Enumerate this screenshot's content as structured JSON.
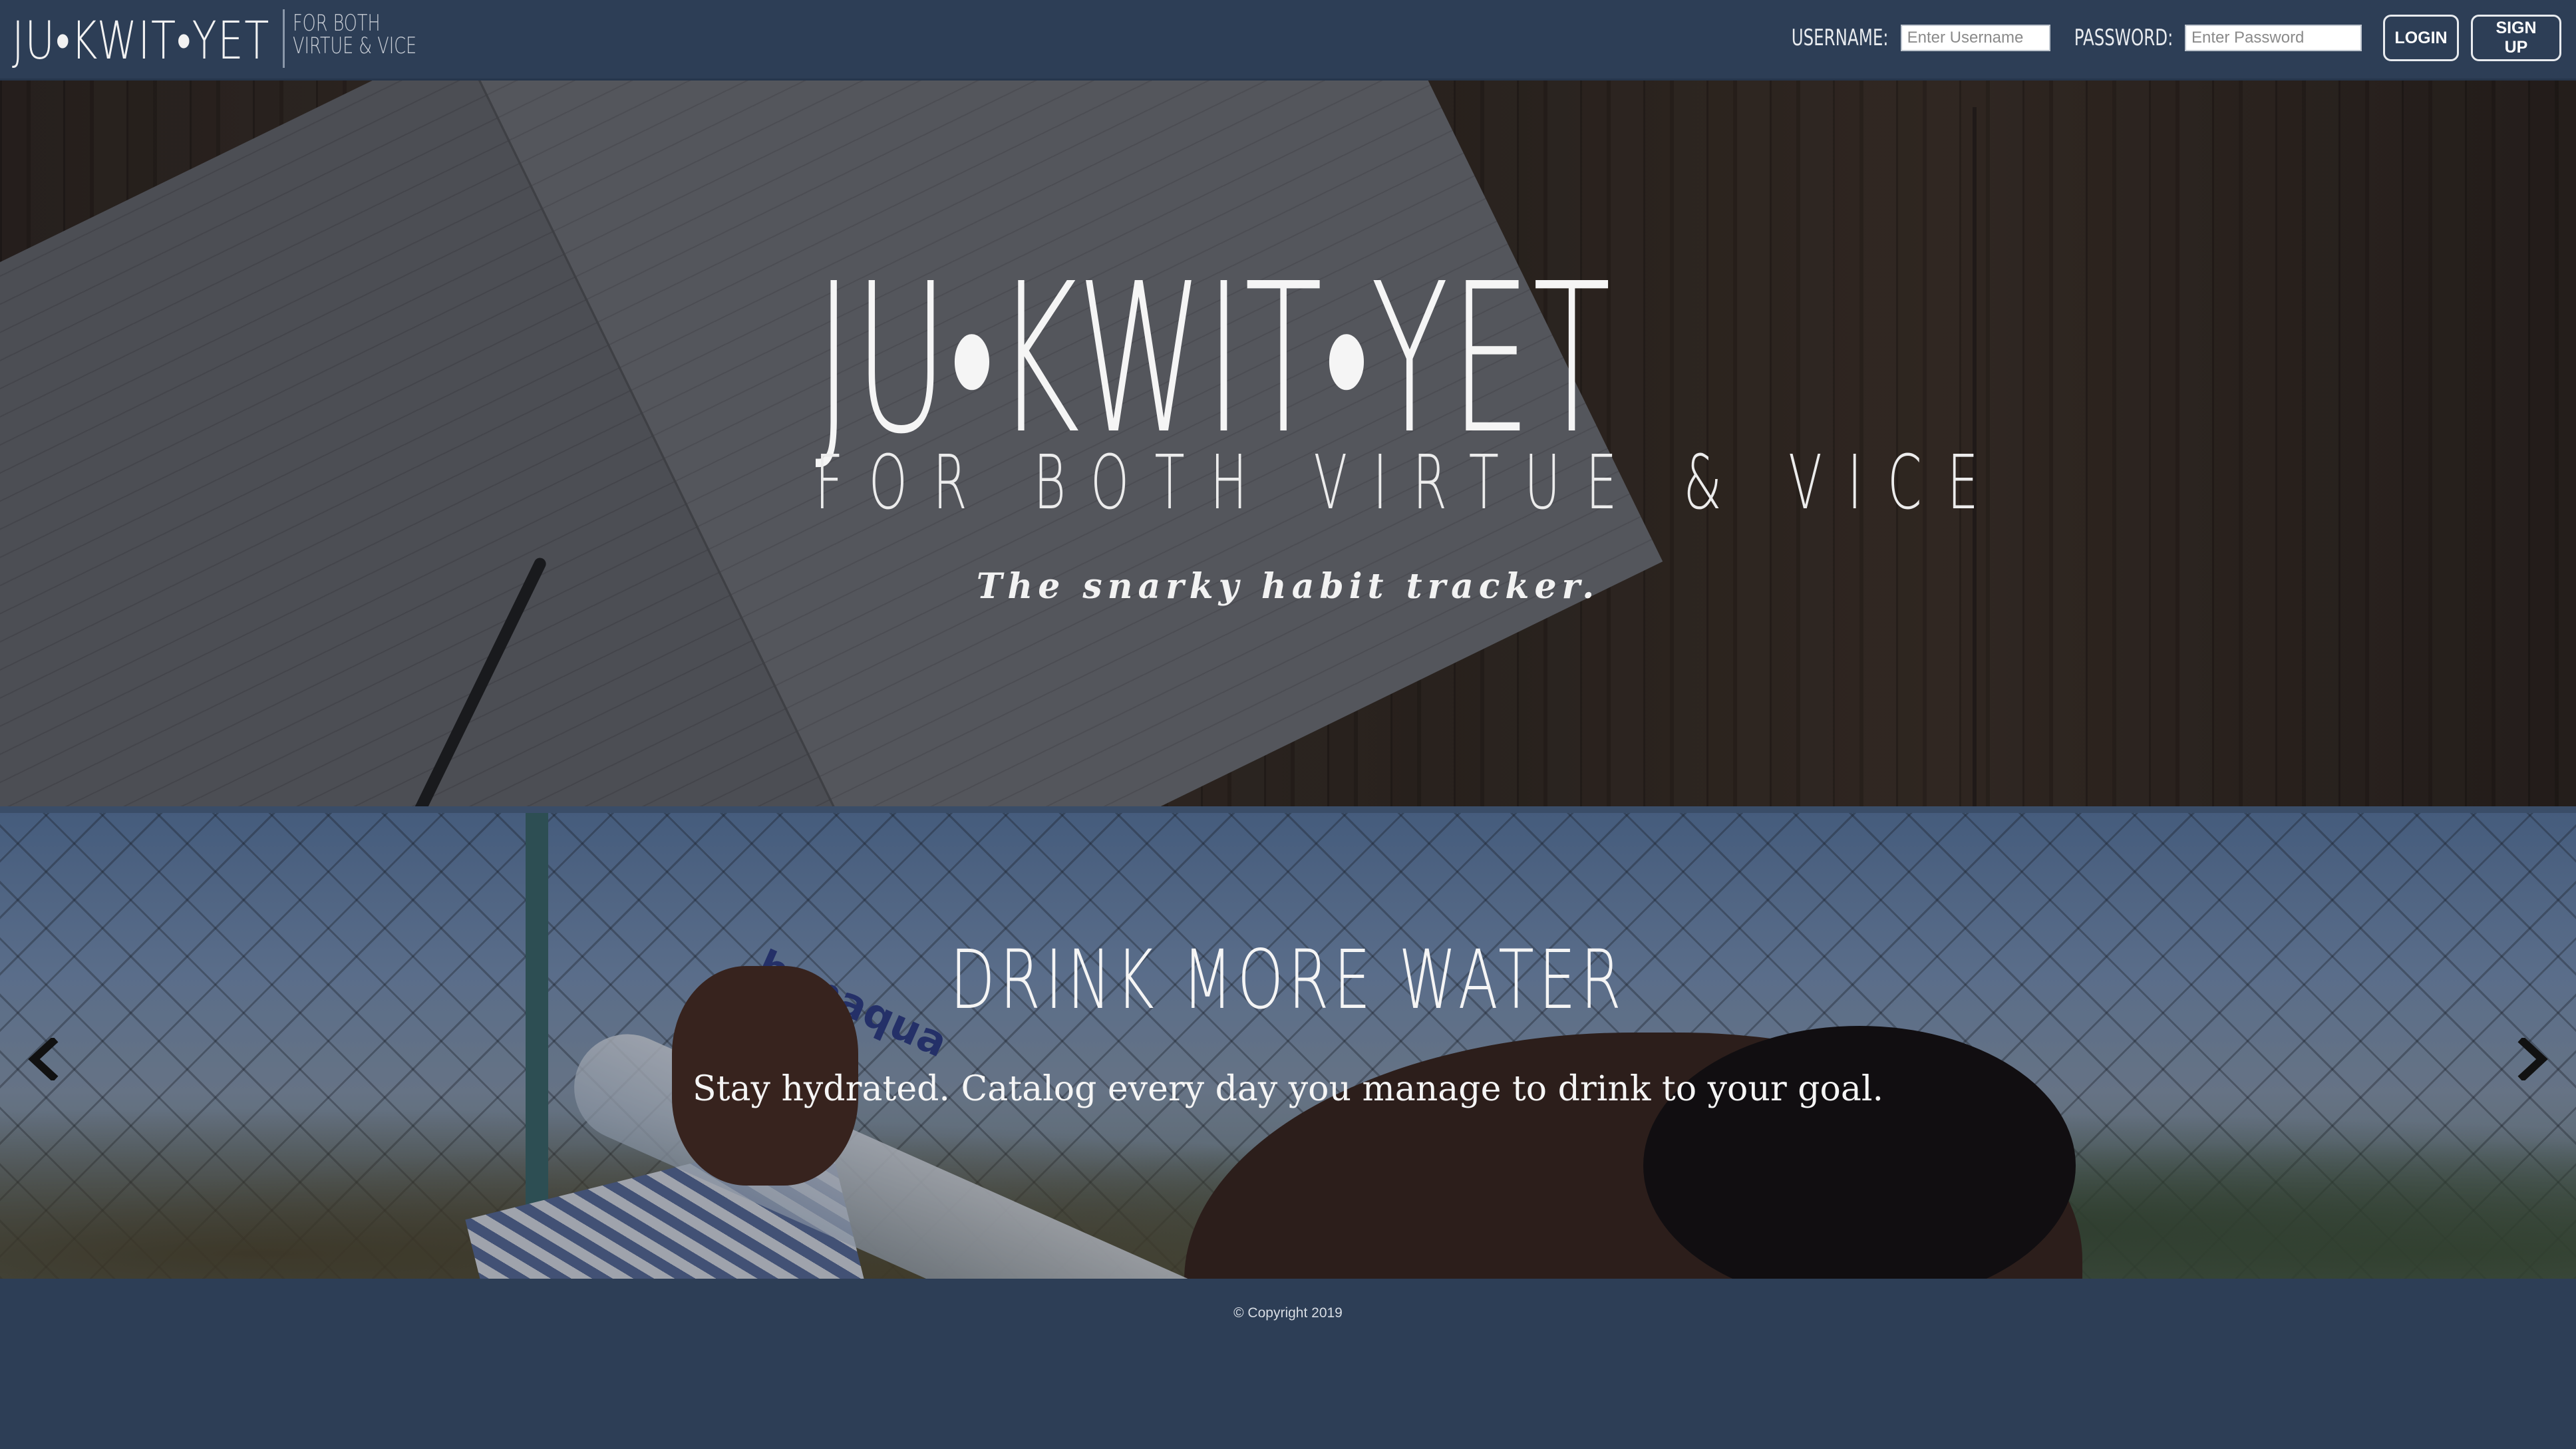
{
  "brand": {
    "logo": "JU•KWIT•YET",
    "tagline_line1": "FOR BOTH",
    "tagline_line2": "VIRTUE & VICE"
  },
  "login": {
    "username_label": "USERNAME:",
    "username_placeholder": "Enter Username",
    "username_value": "",
    "password_label": "PASSWORD:",
    "password_placeholder": "Enter Password",
    "password_value": "",
    "login_button": "LOGIN",
    "signup_button": "SIGN UP"
  },
  "hero": {
    "logo": "JU•KWIT•YET",
    "subtitle": "FOR BOTH VIRTUE & VICE",
    "tagline": "The snarky habit tracker."
  },
  "carousel": {
    "slide_title": "DRINK MORE WATER",
    "slide_text": "Stay hydrated. Catalog every day you manage to drink to your goal.",
    "bottle_brand": "bonaqua",
    "prev_icon": "chevron-left-icon",
    "next_icon": "chevron-right-icon"
  },
  "footer": {
    "copyright": "© Copyright 2019"
  },
  "colors": {
    "navbar_bg": "#2d3e56",
    "footer_bg": "#2d3e56",
    "text": "#ffffff"
  }
}
